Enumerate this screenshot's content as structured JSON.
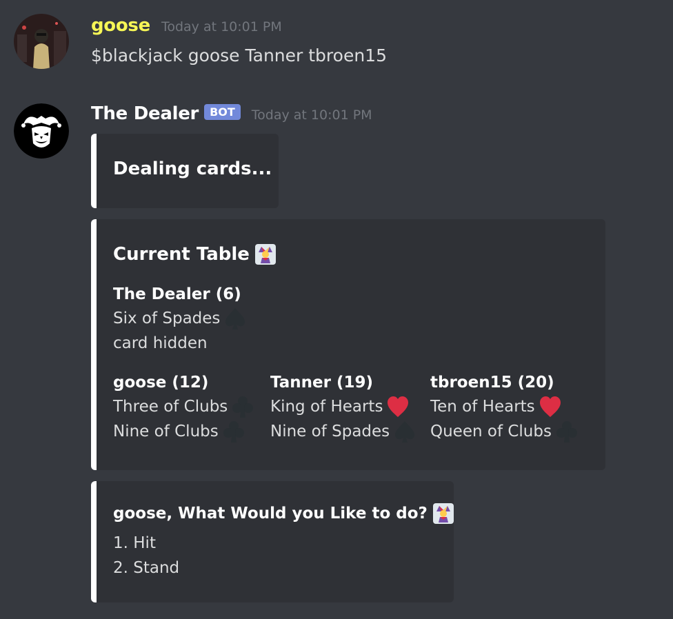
{
  "message1": {
    "username": "goose",
    "username_color": "#f6f656",
    "timestamp": "Today at 10:01 PM",
    "content": "$blackjack goose Tanner tbroen15"
  },
  "message2": {
    "username": "The Dealer",
    "username_color": "#ffffff",
    "bot_tag": "BOT",
    "timestamp": "Today at 10:01 PM",
    "embed_dealing": {
      "title": "Dealing cards..."
    },
    "embed_table": {
      "title": "Current Table",
      "title_icon": "jester-card-emoji",
      "dealer": {
        "name": "The Dealer (6)",
        "cards": [
          {
            "text": "Six of Spades",
            "suit_icon": "spade-icon"
          },
          {
            "text": "card hidden",
            "suit_icon": ""
          }
        ]
      },
      "players": [
        {
          "name": "goose (12)",
          "cards": [
            {
              "text": "Three of Clubs",
              "suit_icon": "club-icon"
            },
            {
              "text": "Nine of Clubs",
              "suit_icon": "club-icon"
            }
          ]
        },
        {
          "name": "Tanner (19)",
          "cards": [
            {
              "text": "King of Hearts",
              "suit_icon": "heart-icon"
            },
            {
              "text": "Nine of Spades",
              "suit_icon": "spade-icon"
            }
          ]
        },
        {
          "name": "tbroen15 (20)",
          "cards": [
            {
              "text": "Ten of Hearts",
              "suit_icon": "heart-icon"
            },
            {
              "text": "Queen of Clubs",
              "suit_icon": "club-icon"
            }
          ]
        }
      ]
    },
    "embed_prompt": {
      "title": "goose, What Would you Like to do?",
      "title_icon": "jester-card-emoji",
      "options": [
        "1. Hit",
        "2. Stand"
      ]
    }
  },
  "colors": {
    "background": "#36393f",
    "embed_background": "#2f3136",
    "embed_border": "#ffffff",
    "bot_tag": "#7289da",
    "heart": "#dd2e44",
    "dark_suit": "#292f33"
  }
}
